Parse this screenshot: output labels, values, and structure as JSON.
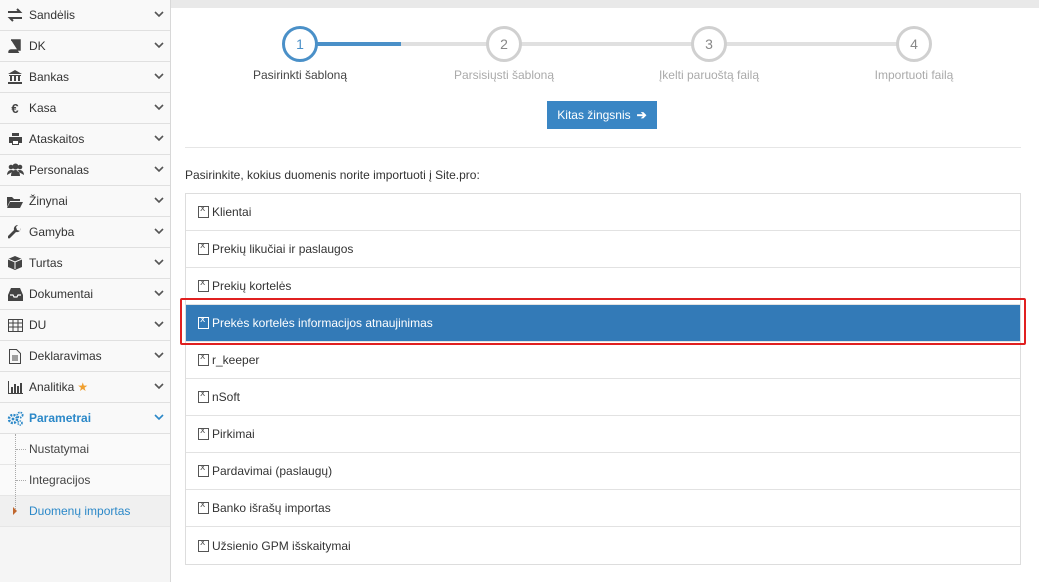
{
  "sidebar": {
    "items": [
      {
        "label": "Sandėlis",
        "icon": "exchange-arrows-icon"
      },
      {
        "label": "DK",
        "icon": "book-icon"
      },
      {
        "label": "Bankas",
        "icon": "bank-icon"
      },
      {
        "label": "Kasa",
        "icon": "euro-icon"
      },
      {
        "label": "Ataskaitos",
        "icon": "printer-icon"
      },
      {
        "label": "Personalas",
        "icon": "users-icon"
      },
      {
        "label": "Žinynai",
        "icon": "folder-open-icon"
      },
      {
        "label": "Gamyba",
        "icon": "wrench-icon"
      },
      {
        "label": "Turtas",
        "icon": "cube-icon"
      },
      {
        "label": "Dokumentai",
        "icon": "inbox-icon"
      },
      {
        "label": "DU",
        "icon": "table-icon"
      },
      {
        "label": "Deklaravimas",
        "icon": "document-icon"
      },
      {
        "label": "Analitika",
        "icon": "bar-chart-icon"
      },
      {
        "label": "Parametrai",
        "icon": "cogs-icon"
      }
    ],
    "subitems": [
      {
        "label": "Nustatymai"
      },
      {
        "label": "Integracijos"
      },
      {
        "label": "Duomenų importas"
      }
    ]
  },
  "wizard": {
    "steps": [
      {
        "number": "1",
        "label": "Pasirinkti šabloną"
      },
      {
        "number": "2",
        "label": "Parsisiųsti šabloną"
      },
      {
        "number": "3",
        "label": "Įkelti paruoštą failą"
      },
      {
        "number": "4",
        "label": "Importuoti failą"
      }
    ],
    "next_label": "Kitas žingsnis",
    "next_arrow": "➔"
  },
  "prompt": "Pasirinkite, kokius duomenis norite importuoti į Site.pro:",
  "import_types": [
    "Klientai",
    "Prekių likučiai ir paslaugos",
    "Prekių kortelės",
    "Prekės kortelės informacijos atnaujinimas",
    "r_keeper",
    "nSoft",
    "Pirkimai",
    "Pardavimai (paslaugų)",
    "Banko išrašų importas",
    "Užsienio GPM išskaitymai"
  ],
  "colors": {
    "accent": "#337ab7",
    "active_step": "#4a90c8",
    "highlight_border": "#e02020",
    "star": "#f0a030"
  }
}
